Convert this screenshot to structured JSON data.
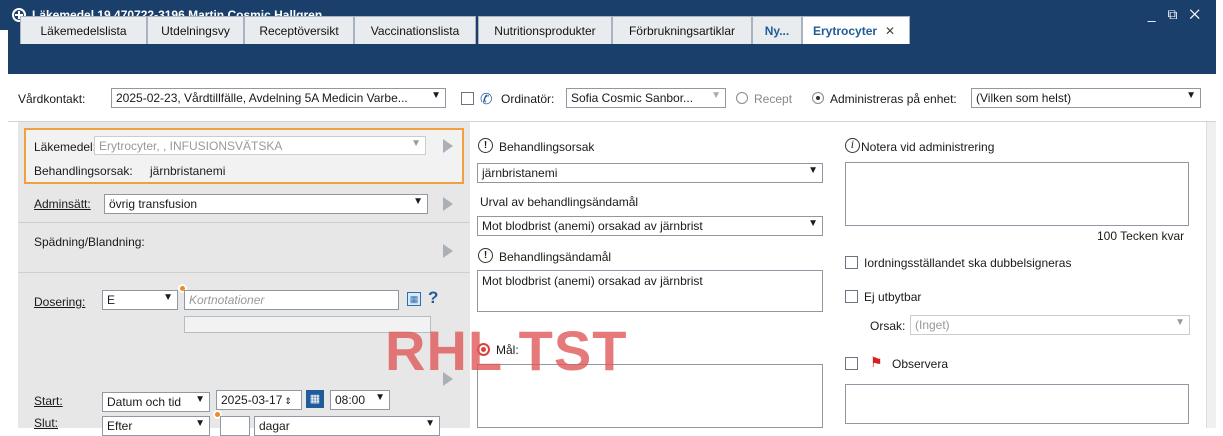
{
  "window": {
    "title": "Läkemedel 19 470722-3196 Martin Cosmic Hallgren",
    "controls": "_ ⧉ ✕"
  },
  "tabs": [
    {
      "label": "Läkemedelslista"
    },
    {
      "label": "Utdelningsvy"
    },
    {
      "label": "Receptöversikt"
    },
    {
      "label": "Vaccinationslista"
    },
    {
      "label": "Nutritionsprodukter"
    },
    {
      "label": "Förbrukningsartiklar"
    },
    {
      "label": "Ny..."
    },
    {
      "label": "Erytrocyter",
      "close": "✕"
    }
  ],
  "context": {
    "vardkontakt_label": "Vårdkontakt:",
    "vardkontakt_value": "2025-02-23, Vårdtillfälle, Avdelning 5A Medicin Varbe...",
    "ordinator_label": "Ordinatör:",
    "ordinator_value": "Sofia Cosmic Sanbor...",
    "recept_label": "Recept",
    "admin_enhet_label": "Administreras på enhet:",
    "admin_enhet_value": "(Vilken som helst)"
  },
  "left": {
    "lakemedel_label": "Läkemedel:",
    "lakemedel_value": "Erytrocyter, , INFUSIONSVÄTSKA",
    "behandlingsorsak_label": "Behandlingsorsak:",
    "behandlingsorsak_value": "järnbristanemi",
    "adminsatt_label": "Adminsätt:",
    "adminsatt_value": "övrig transfusion",
    "spadning_label": "Spädning/Blandning:",
    "dosering_label": "Dosering:",
    "dosering_value": "E",
    "kortnotationer_placeholder": "Kortnotationer",
    "help": "?",
    "start_label": "Start:",
    "start_type": "Datum och tid",
    "start_date": "2025-03-17",
    "start_time": "08:00",
    "slut_label": "Slut:",
    "slut_type": "Efter",
    "slut_unit": "dagar"
  },
  "middle": {
    "behandlingsorsak_heading": "Behandlingsorsak",
    "behandlingsorsak_value": "järnbristanemi",
    "urval_label": "Urval av behandlingsändamål",
    "urval_value": "Mot blodbrist (anemi) orsakad av järnbrist",
    "andamal_heading": "Behandlingsändamål",
    "andamal_text": "Mot blodbrist (anemi) orsakad av järnbrist",
    "mal_label": "Mål:"
  },
  "right": {
    "notera_heading": "Notera vid administrering",
    "tecken_kvar": "100 Tecken kvar",
    "dubbelsigneras_label": "Iordningsställandet ska dubbelsigneras",
    "ej_utbytbar_label": "Ej utbytbar",
    "orsak_label": "Orsak:",
    "orsak_value": "(Inget)",
    "observera_label": "Observera"
  },
  "watermark": "RHL TST",
  "colors": {
    "titlebar": "#1a3f6b",
    "accent": "#1f5c99",
    "highlight_border": "#f0a040",
    "watermark": "#e05858"
  }
}
